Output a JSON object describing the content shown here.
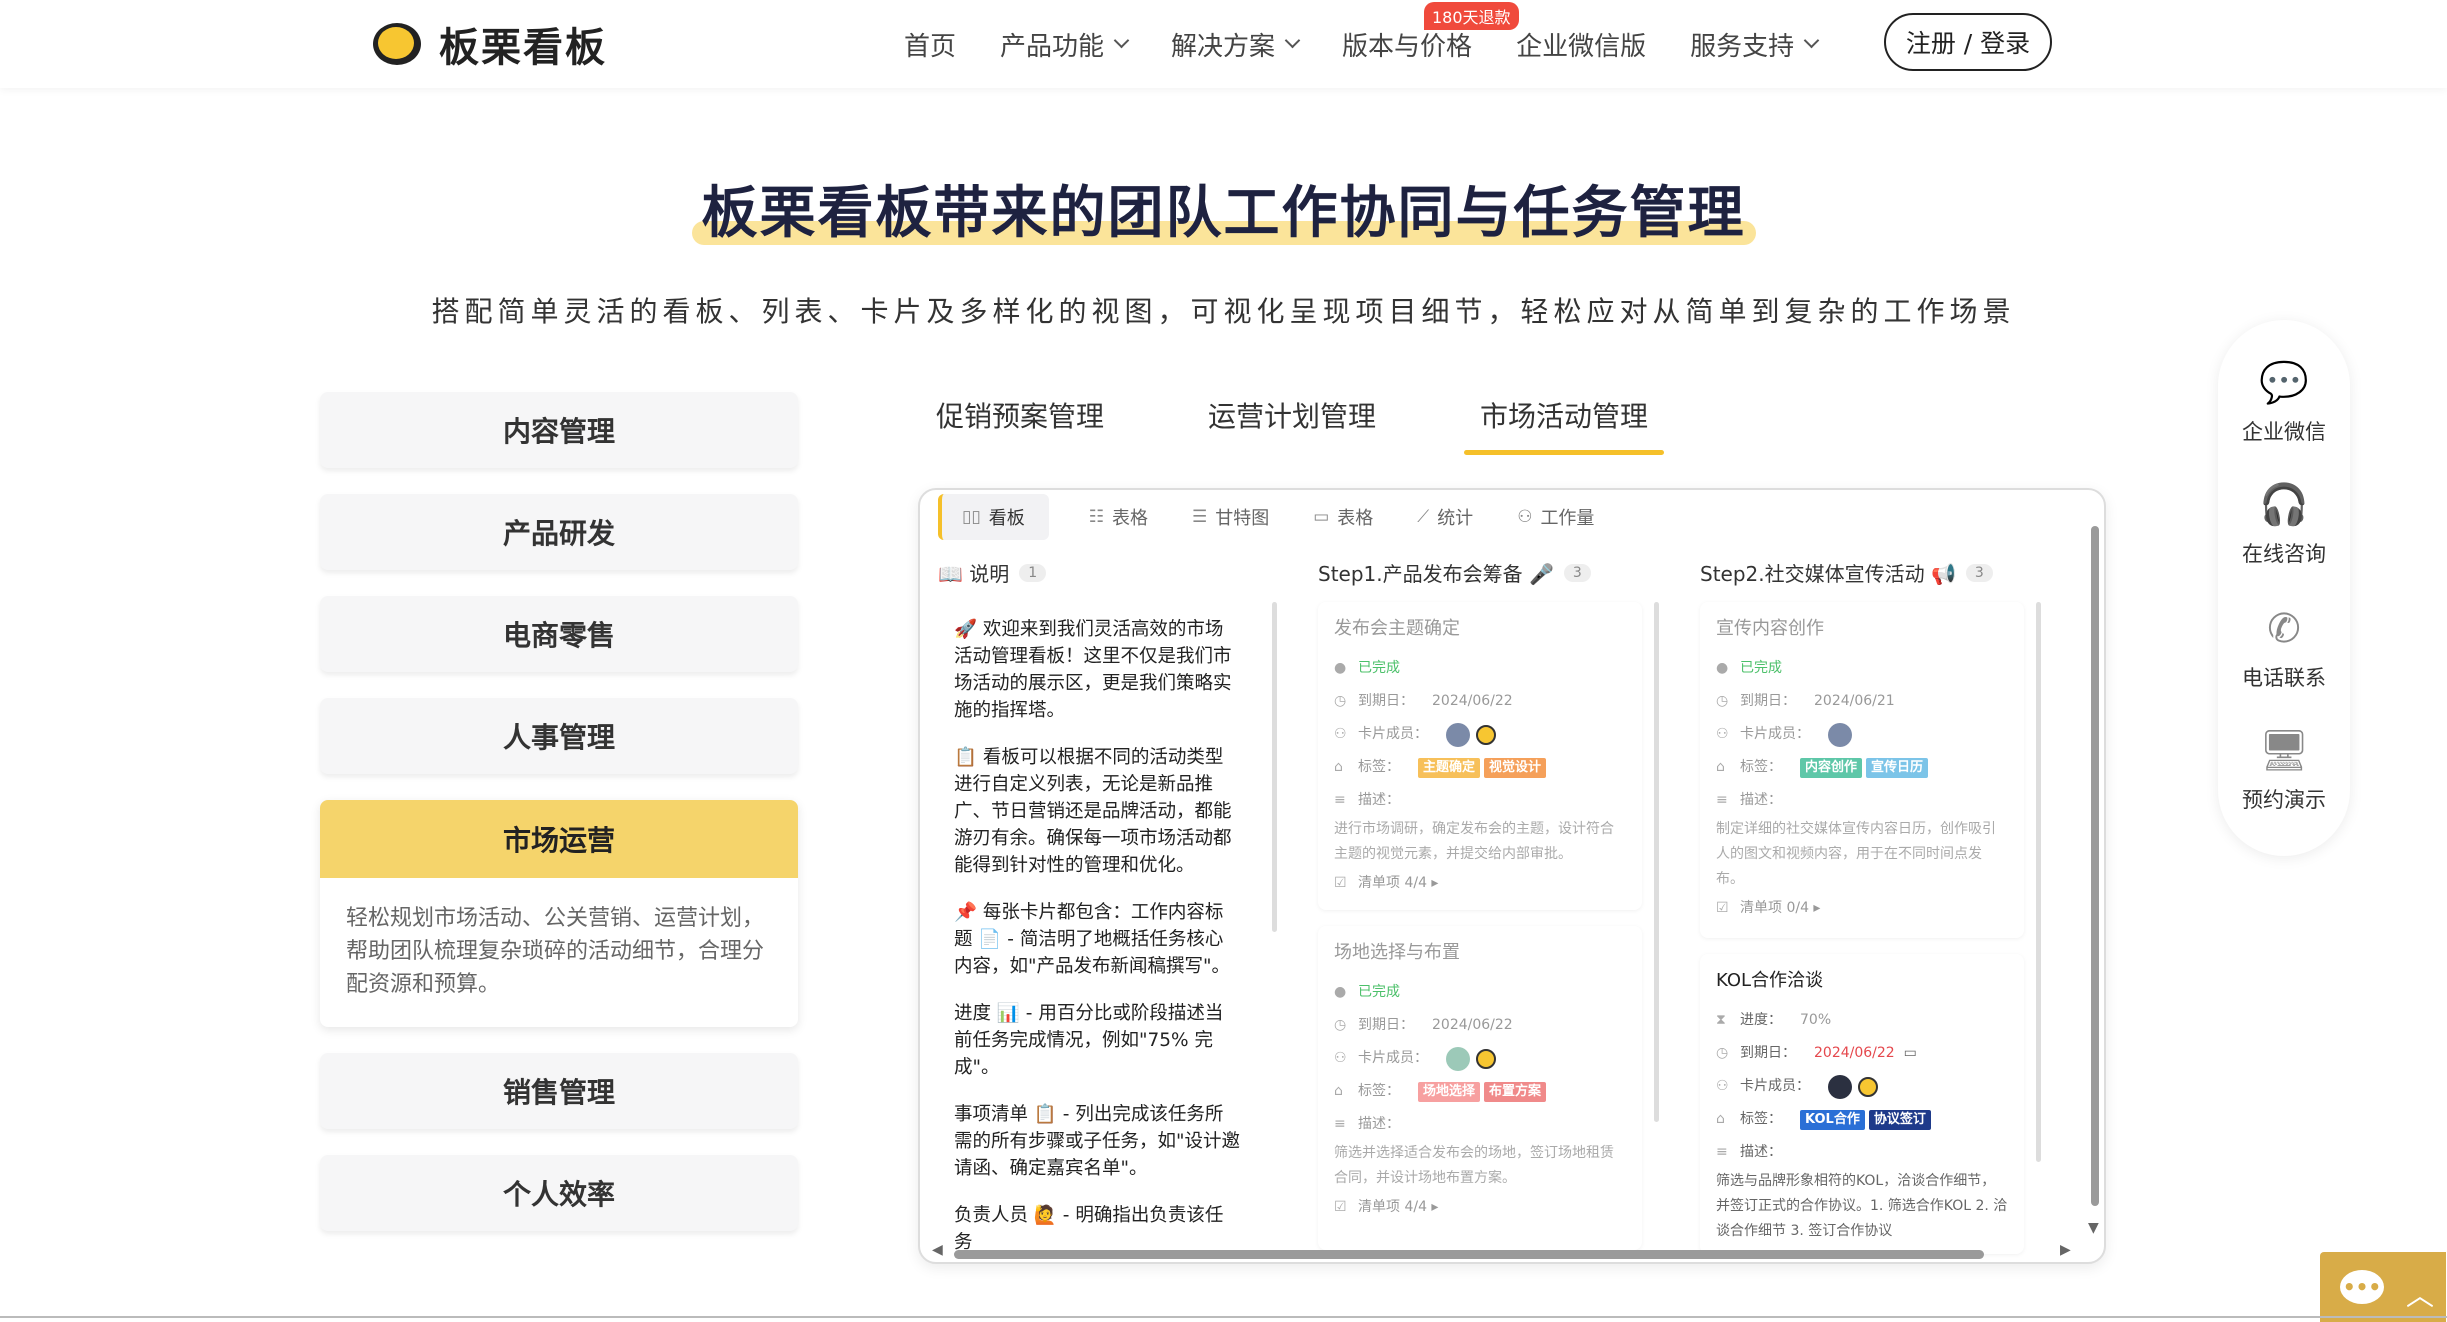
{
  "header": {
    "logo_text": "板栗看板",
    "nav": [
      {
        "label": "首页",
        "dropdown": false
      },
      {
        "label": "产品功能",
        "dropdown": true
      },
      {
        "label": "解决方案",
        "dropdown": true
      },
      {
        "label": "版本与价格",
        "dropdown": false
      },
      {
        "label": "企业微信版",
        "dropdown": false
      },
      {
        "label": "服务支持",
        "dropdown": true
      }
    ],
    "badge": "180天退款",
    "login": "注册 / 登录"
  },
  "hero": {
    "title": "板栗看板带来的团队工作协同与任务管理",
    "subtitle": "搭配简单灵活的看板、列表、卡片及多样化的视图，可视化呈现项目细节，轻松应对从简单到复杂的工作场景"
  },
  "menu": {
    "items": [
      "内容管理",
      "产品研发",
      "电商零售",
      "人事管理"
    ],
    "active": {
      "label": "市场运营",
      "desc": "轻松规划市场活动、公关营销、运营计划，帮助团队梳理复杂琐碎的活动细节，合理分配资源和预算。"
    },
    "items_after": [
      "销售管理",
      "个人效率"
    ]
  },
  "tabs": [
    "促销预案管理",
    "运营计划管理",
    "市场活动管理"
  ],
  "board": {
    "views": [
      {
        "icon": "kanban-icon",
        "glyph": "▯▯",
        "label": "看板",
        "active": true
      },
      {
        "icon": "list-icon",
        "glyph": "☷",
        "label": "表格"
      },
      {
        "icon": "gantt-icon",
        "glyph": "☰",
        "label": "甘特图"
      },
      {
        "icon": "calendar-icon",
        "glyph": "▭",
        "label": "表格"
      },
      {
        "icon": "chart-icon",
        "glyph": "⟋",
        "label": "统计"
      },
      {
        "icon": "workload-icon",
        "glyph": "⚇",
        "label": "工作量"
      }
    ],
    "columns": [
      {
        "title": "📖 说明",
        "count": "1"
      },
      {
        "title": "Step1.产品发布会筹备 🎤",
        "count": "3"
      },
      {
        "title": "Step2.社交媒体宣传活动 📢",
        "count": "3"
      }
    ],
    "intro": [
      "🚀 欢迎来到我们灵活高效的市场活动管理看板！这里不仅是我们市场活动的展示区，更是我们策略实施的指挥塔。",
      "📋 看板可以根据不同的活动类型进行自定义列表，无论是新品推广、节日营销还是品牌活动，都能游刃有余。确保每一项市场活动都能得到针对性的管理和优化。",
      "📌 每张卡片都包含：工作内容标题 📄 - 简洁明了地概括任务核心内容，如\"产品发布新闻稿撰写\"。",
      "进度 📊 - 用百分比或阶段描述当前任务完成情况，例如\"75% 完成\"。",
      "事项清单 📋 - 列出完成该任务所需的所有步骤或子任务，如\"设计邀请函、确定嘉宾名单\"。",
      "负责人员 🙋 - 明确指出负责该任务"
    ],
    "labels": {
      "done": "已完成",
      "due": "到期日：",
      "members": "卡片成员：",
      "tags": "标签：",
      "desc": "描述：",
      "progress": "进度：",
      "checklist_prefix": "清单项"
    },
    "cards_step1": [
      {
        "title": "发布会主题确定",
        "due": "2024/06/22",
        "tags": [
          {
            "text": "主题确定",
            "color": "#f7c05a"
          },
          {
            "text": "视觉设计",
            "color": "#f5a05a"
          }
        ],
        "desc": "进行市场调研，确定发布会的主题，设计符合主题的视觉元素，并提交给内部审批。",
        "checklist": "4/4"
      },
      {
        "title": "场地选择与布置",
        "due": "2024/06/22",
        "tags": [
          {
            "text": "场地选择",
            "color": "#f7a0a0"
          },
          {
            "text": "布置方案",
            "color": "#f08a8a"
          }
        ],
        "desc": "筛选并选择适合发布会的场地，签订场地租赁合同，并设计场地布置方案。",
        "checklist": "4/4"
      }
    ],
    "cards_step2": [
      {
        "title": "宣传内容创作",
        "due": "2024/06/21",
        "tags": [
          {
            "text": "内容创作",
            "color": "#5ec7a8"
          },
          {
            "text": "宣传日历",
            "color": "#7cc4e8"
          }
        ],
        "desc": "制定详细的社交媒体宣传内容日历，创作吸引人的图文和视频内容，用于在不同时间点发布。",
        "checklist": "0/4"
      },
      {
        "title": "KOL合作洽谈",
        "progress": "70%",
        "due": "2024/06/22",
        "tags": [
          {
            "text": "KOL合作",
            "color": "#2a6fd6"
          },
          {
            "text": "协议签订",
            "color": "#1e3a8a"
          }
        ],
        "desc": "筛选与品牌形象相符的KOL，洽谈合作细节，并签订正式的合作协议。1. 筛选合作KOL 2. 洽谈合作细节 3. 签订合作协议"
      }
    ]
  },
  "side": [
    {
      "icon": "wechat-work-icon",
      "glyph": "💬",
      "label": "企业微信"
    },
    {
      "icon": "headset-icon",
      "glyph": "🎧",
      "label": "在线咨询"
    },
    {
      "icon": "phone-icon",
      "glyph": "✆",
      "label": "电话联系"
    },
    {
      "icon": "monitor-icon",
      "glyph": "🖥",
      "label": "预约演示"
    }
  ],
  "colors": {
    "accent": "#f5c02a",
    "menu_active": "#f5d46b",
    "due_red": "#e5484d"
  }
}
